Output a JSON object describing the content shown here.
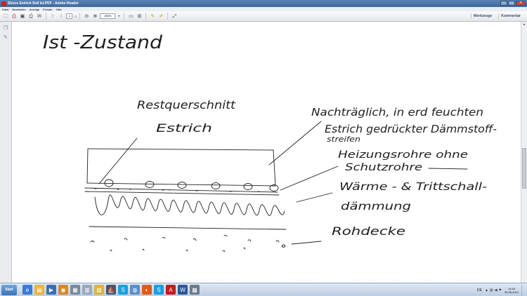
{
  "window": {
    "title": "Skizze Estrich Soll Ist.PDF - Adobe Reader",
    "controls": {
      "minimize": "–",
      "maximize": "□",
      "close": "✕"
    }
  },
  "menu": [
    "Datei",
    "Bearbeiten",
    "Anzeige",
    "Fenster",
    "Hilfe"
  ],
  "toolbar": {
    "page_current": "1",
    "page_total": "/ 1",
    "zoom_value": "283%",
    "right_buttons": {
      "tools": "Werkzeuge",
      "comment": "Kommentar"
    }
  },
  "document": {
    "heading": "Ist -Zustand",
    "labels": {
      "restquerschnitt_line1": "Restquerschnitt",
      "restquerschnitt_line2": "Estrich",
      "nachtraeglich_line1": "Nachträglich, in erd feuchten",
      "nachtraeglich_line2": "Estrich gedrückter Dämmstoff-",
      "nachtraeglich_line3": "streifen",
      "heizung_line1": "Heizungsrohre ohne",
      "heizung_line2": "Schutzrohre",
      "waerme_line1": "Wärme - & Trittschall-",
      "waerme_line2": "dämmung",
      "rohdecke": "Rohdecke"
    }
  },
  "taskbar": {
    "start_label": "Start",
    "language": "DE",
    "time": "14:45",
    "date": "30.05.2014"
  }
}
